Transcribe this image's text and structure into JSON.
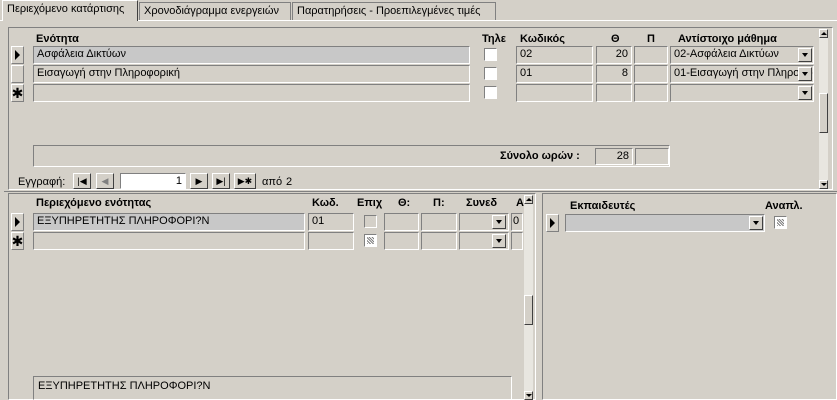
{
  "tabs": [
    {
      "label": "Περιεχόμενο κατάρτισης"
    },
    {
      "label": "Χρονοδιάγραμμα ενεργειών"
    },
    {
      "label": "Παρατηρήσεις - Προεπιλεγμένες τιμές"
    }
  ],
  "units_grid": {
    "headers": {
      "unit": "Ενότητα",
      "remote": "Τηλε",
      "code": "Κωδικός",
      "theory": "Θ",
      "practice": "Π",
      "course": "Αντίστοιχο μάθημα"
    },
    "rows": [
      {
        "unit": "Ασφάλεια Δικτύων",
        "code": "02",
        "theory": "20",
        "practice": "",
        "course": "02-Ασφάλεια Δικτύων"
      },
      {
        "unit": "Εισαγωγή στην Πληροφορική",
        "code": "01",
        "theory": "8",
        "practice": "",
        "course": "01-Εισαγωγή στην Πληροφο"
      }
    ],
    "new_row_marker": "✱",
    "total_label": "Σύνολο ωρών :",
    "total_value": "28",
    "total_value2": ""
  },
  "navigator": {
    "label": "Εγγραφή:",
    "current": "1",
    "of_label": "από",
    "total": "2"
  },
  "content_grid": {
    "headers": {
      "content": "Περιεχόμενο ενότητας",
      "code": "Κωδ.",
      "check": "Επιχ",
      "theory": "Θ:",
      "practice": "Π:",
      "session": "Συνεδ",
      "extra": "Α"
    },
    "rows": [
      {
        "content": "ΕΞΥΠΗΡΕΤΗΤΗΣ ΠΛΗΡΟΦΟΡΙ?Ν",
        "code": "01",
        "extra": "0"
      }
    ],
    "memo": "ΕΞΥΠΗΡΕΤΗΤΗΣ ΠΛΗΡΟΦΟΡΙ?Ν"
  },
  "trainers_grid": {
    "headers": {
      "trainers": "Εκπαιδευτές",
      "replacement": "Αναπλ."
    }
  }
}
